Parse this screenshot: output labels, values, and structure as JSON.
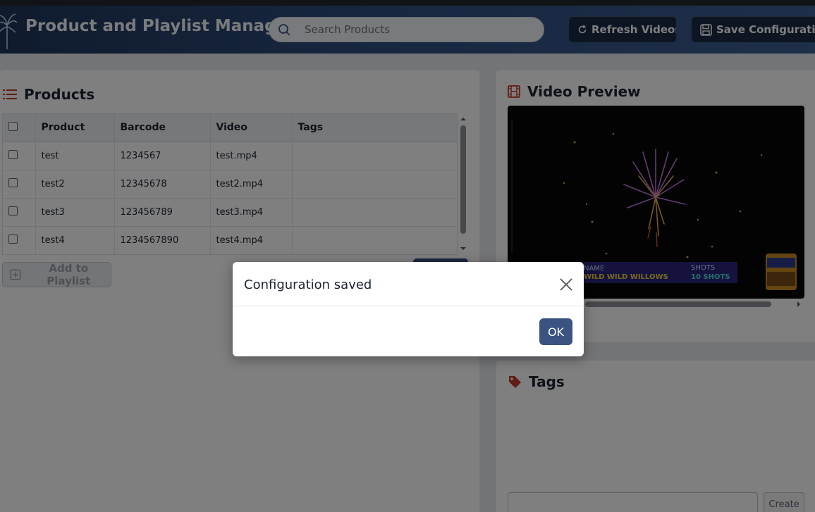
{
  "header": {
    "title": "Product and Playlist Manager",
    "search_placeholder": "Search Products",
    "refresh_label": "Refresh Videos",
    "save_label": "Save Configuration"
  },
  "products": {
    "title": "Products",
    "columns": [
      "Product",
      "Barcode",
      "Video",
      "Tags"
    ],
    "rows": [
      {
        "product": "test",
        "barcode": "1234567",
        "video": "test.mp4",
        "tags": ""
      },
      {
        "product": "test2",
        "barcode": "12345678",
        "video": "test2.mp4",
        "tags": ""
      },
      {
        "product": "test3",
        "barcode": "123456789",
        "video": "test3.mp4",
        "tags": ""
      },
      {
        "product": "test4",
        "barcode": "1234567890",
        "video": "test4.mp4",
        "tags": ""
      }
    ],
    "add_label": "Add to Playlist"
  },
  "video": {
    "title": "Video Preview",
    "overlay_name_label": "NAME",
    "overlay_name": "WILD WILD WILLOWS",
    "overlay_shots_label": "SHOTS",
    "overlay_shots": "10 SHOTS"
  },
  "tags": {
    "title": "Tags",
    "create_label": "Create"
  },
  "modal": {
    "title": "Configuration saved",
    "ok_label": "OK"
  },
  "colors": {
    "accent": "#3a5380",
    "header_dark": "#1f355a",
    "icon_red": "#c0392b"
  }
}
